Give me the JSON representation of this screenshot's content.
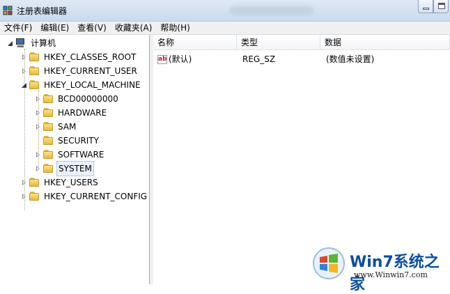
{
  "window": {
    "title": "注册表编辑器",
    "app_icon": "regedit-icon",
    "controls": [
      "minimize-icon",
      "maximize-icon"
    ]
  },
  "menubar": {
    "items": [
      "文件(F)",
      "编辑(E)",
      "查看(V)",
      "收藏夹(A)",
      "帮助(H)"
    ]
  },
  "tree": {
    "root": "计算机",
    "hives": [
      {
        "label": "HKEY_CLASSES_ROOT",
        "expanded": false
      },
      {
        "label": "HKEY_CURRENT_USER",
        "expanded": false
      },
      {
        "label": "HKEY_LOCAL_MACHINE",
        "expanded": true,
        "children": [
          {
            "label": "BCD00000000",
            "expanded": false
          },
          {
            "label": "HARDWARE",
            "expanded": false
          },
          {
            "label": "SAM",
            "expanded": false
          },
          {
            "label": "SECURITY",
            "expanded": false
          },
          {
            "label": "SOFTWARE",
            "expanded": false
          },
          {
            "label": "SYSTEM",
            "expanded": false,
            "selected": true
          }
        ]
      },
      {
        "label": "HKEY_USERS",
        "expanded": false
      },
      {
        "label": "HKEY_CURRENT_CONFIG",
        "expanded": false
      }
    ]
  },
  "list": {
    "columns": [
      "名称",
      "类型",
      "数据"
    ],
    "rows": [
      {
        "name": "(默认)",
        "type": "REG_SZ",
        "data": "(数值未设置)",
        "icon": "string-value-icon"
      }
    ]
  },
  "watermark": {
    "brand_prefix": "Win7",
    "brand_suffix": "系统之家",
    "url": "www.Winwin7.com"
  },
  "colors": {
    "selection_bg": "#e8f0fb",
    "brand_blue": "#0b4ea2"
  }
}
